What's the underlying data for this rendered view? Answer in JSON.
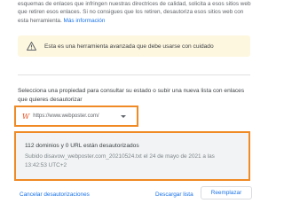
{
  "intro": {
    "text": "esquemas de enlaces que infringen nuestras directrices de calidad, solicita a esos sitios web que retiren esos enlaces. Si no consigues que los retiren, desautoriza esos sitios web con esta herramienta.",
    "link": "Más información"
  },
  "warning": {
    "icon": "warning-triangle-icon",
    "text": "Esta es una herramienta avanzada que debe usarse con cuidado",
    "color": "#fef7e0"
  },
  "select_prompt": "Selecciona una propiedad para consultar su estado o subir una nueva lista con enlaces que quieres desautorizar",
  "property": {
    "logo": "W",
    "url": "https://www.webposter.com/"
  },
  "status": {
    "title": "112 dominios y 0 URL están desautorizados",
    "detail": "Subido disavow_webposter.com_20210524.txt el 24 de mayo de 2021 a las 13:42:53 UTC+2"
  },
  "footer": {
    "cancel_label": "Cancelar desautorizaciones",
    "download_label": "Descargar lista",
    "replace_label": "Reemplazar"
  },
  "colors": {
    "accent": "#1a73e8",
    "highlight": "#f08a24"
  }
}
